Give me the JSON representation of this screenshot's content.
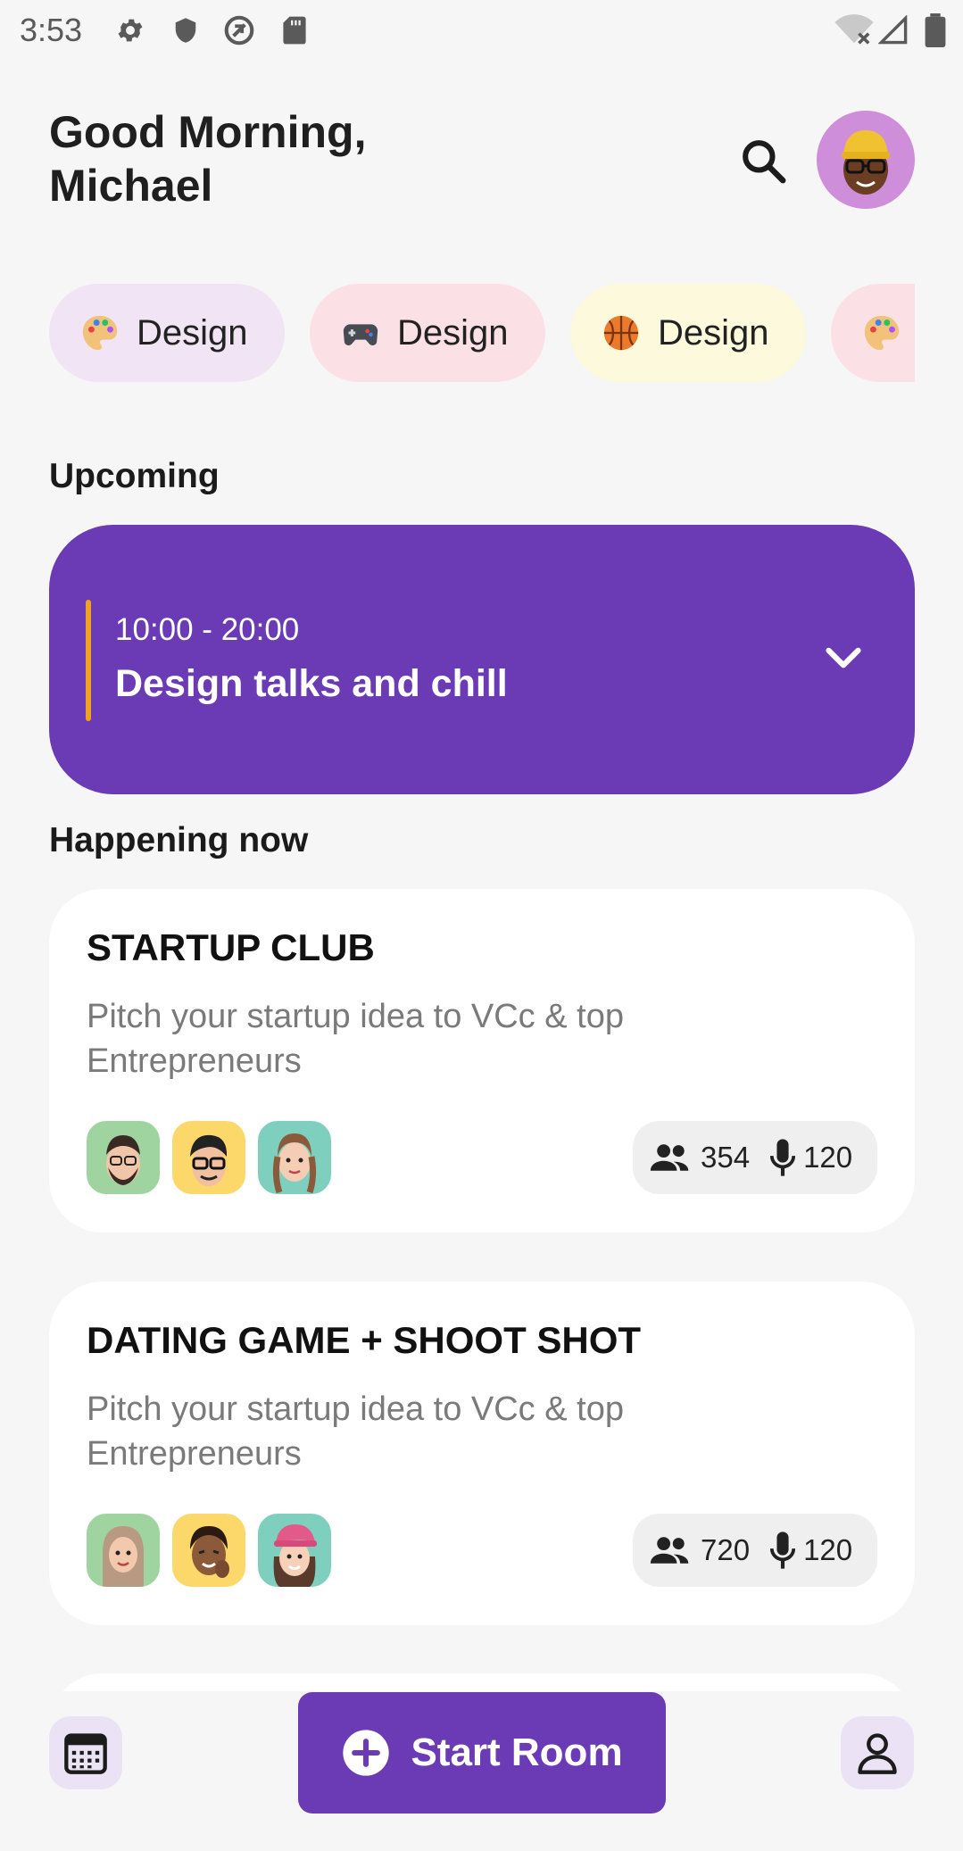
{
  "status_bar": {
    "time": "3:53",
    "left_icons": [
      "settings-icon",
      "shield-icon",
      "no-sync-icon",
      "sd-card-icon"
    ],
    "right_icons": [
      "wifi-off-icon",
      "signal-icon",
      "battery-icon"
    ]
  },
  "header": {
    "greeting_line1": "Good Morning,",
    "greeting_line2": "Michael"
  },
  "chips": [
    {
      "emoji": "palette-icon",
      "label": "Design",
      "color": "#f1e4f4"
    },
    {
      "emoji": "gamepad-icon",
      "label": "Design",
      "color": "#fbe1e6"
    },
    {
      "emoji": "basketball-icon",
      "label": "Design",
      "color": "#fdf9dc"
    },
    {
      "emoji": "palette-icon",
      "label": "",
      "color": "#fbe1e6"
    }
  ],
  "upcoming": {
    "title": "Upcoming",
    "time": "10:00 - 20:00",
    "event": "Design talks and chill"
  },
  "happening": {
    "title": "Happening now",
    "rooms": [
      {
        "title": "STARTUP CLUB",
        "description": "Pitch your startup idea to VCc & top Entrepreneurs",
        "listeners": "354",
        "speakers": "120"
      },
      {
        "title": "DATING GAME + SHOOT SHOT",
        "description": "Pitch your startup idea to VCc & top Entrepreneurs",
        "listeners": "720",
        "speakers": "120"
      }
    ]
  },
  "bottom": {
    "start_label": "Start Room"
  },
  "colors": {
    "accent": "#6a3bb5",
    "upcoming_bar": "#f0a320",
    "background": "#f6f6f6"
  }
}
